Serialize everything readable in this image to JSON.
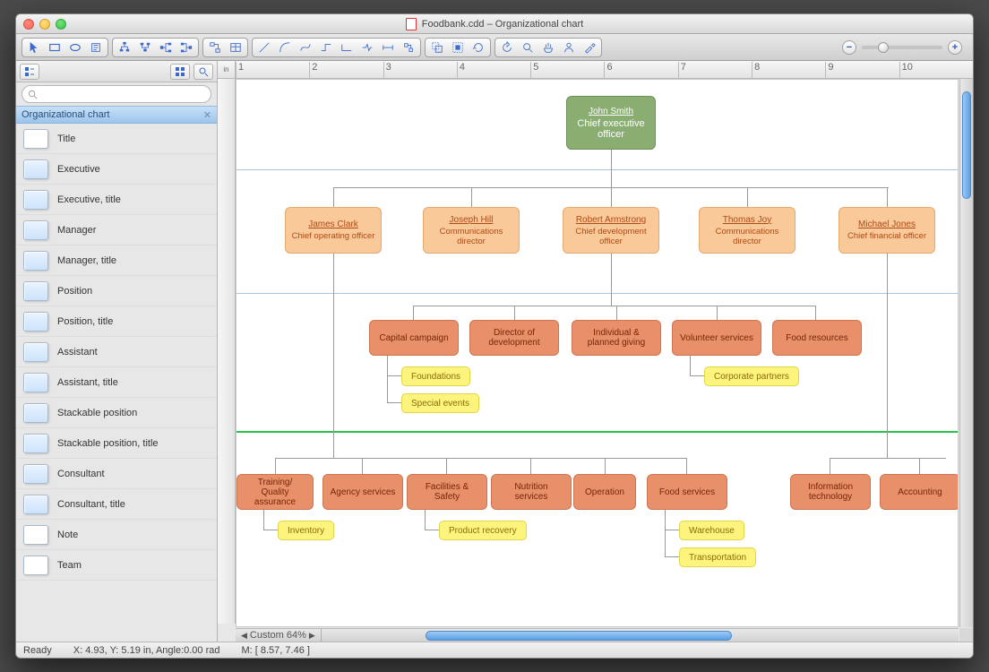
{
  "window": {
    "title": "Foodbank.cdd – Organizational chart"
  },
  "ruler": {
    "unit": "in",
    "ticks": [
      "1",
      "2",
      "3",
      "4",
      "5",
      "6",
      "7",
      "8",
      "9",
      "10"
    ]
  },
  "sidebar": {
    "section": "Organizational chart",
    "items": [
      {
        "label": "Title"
      },
      {
        "label": "Executive"
      },
      {
        "label": "Executive, title"
      },
      {
        "label": "Manager"
      },
      {
        "label": "Manager, title"
      },
      {
        "label": "Position"
      },
      {
        "label": "Position, title"
      },
      {
        "label": "Assistant"
      },
      {
        "label": "Assistant, title"
      },
      {
        "label": "Stackable position"
      },
      {
        "label": "Stackable position, title"
      },
      {
        "label": "Consultant"
      },
      {
        "label": "Consultant, title"
      },
      {
        "label": "Note"
      },
      {
        "label": "Team"
      }
    ]
  },
  "zoom": {
    "label": "Custom 64%"
  },
  "status": {
    "ready": "Ready",
    "coords": "X: 4.93, Y: 5.19 in, Angle:0.00 rad",
    "mouse": "M: [ 8.57, 7.46 ]"
  },
  "chart_data": {
    "type": "org-chart",
    "root": {
      "name": "John Smith",
      "role": "Chief executive officer",
      "kind": "exec"
    },
    "managers": [
      {
        "name": "James Clark",
        "role": "Chief operating officer"
      },
      {
        "name": "Joseph Hill",
        "role": "Communications director"
      },
      {
        "name": "Robert Armstrong",
        "role": "Chief development officer"
      },
      {
        "name": "Thomas Joy",
        "role": "Communications director"
      },
      {
        "name": "Michael Jones",
        "role": "Chief financial officer"
      }
    ],
    "positions_row1": [
      "Capital campaign",
      "Director of development",
      "Individual & planned giving",
      "Volunteer services",
      "Food resources"
    ],
    "assistants_row1": [
      {
        "label": "Foundations",
        "parent": "Capital campaign"
      },
      {
        "label": "Special events",
        "parent": "Capital campaign"
      },
      {
        "label": "Corporate partners",
        "parent": "Volunteer services"
      }
    ],
    "positions_row2": [
      "Training/ Quality assurance",
      "Agency services",
      "Facilities & Safety",
      "Nutrition services",
      "Operation",
      "Food services",
      "Information technology",
      "Accounting"
    ],
    "assistants_row2": [
      {
        "label": "Inventory",
        "parent": "Training/ Quality assurance"
      },
      {
        "label": "Product recovery",
        "parent": "Facilities & Safety"
      },
      {
        "label": "Warehouse",
        "parent": "Food services"
      },
      {
        "label": "Transportation",
        "parent": "Food services"
      }
    ]
  }
}
